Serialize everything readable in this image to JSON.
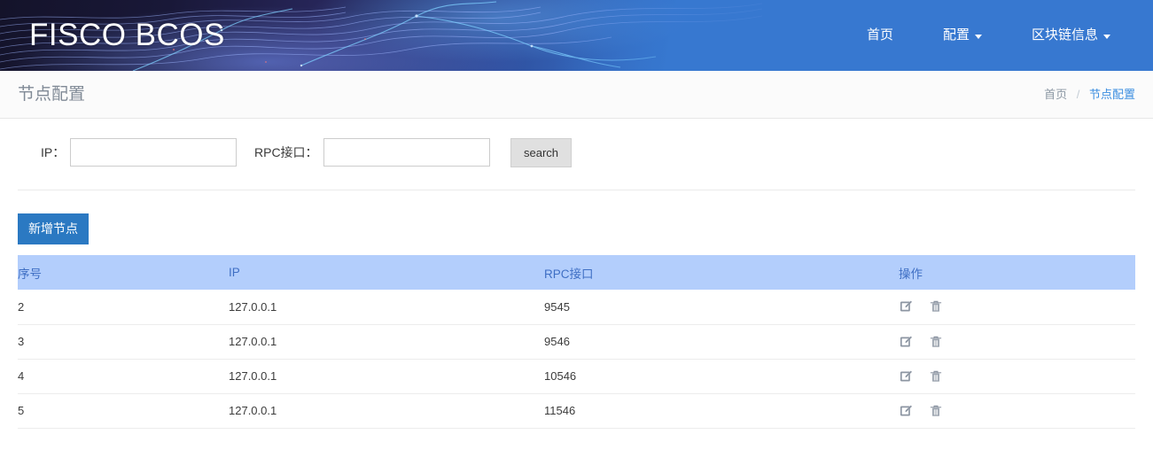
{
  "header": {
    "logo": "FISCO BCOS",
    "brand_color": "#3778d0",
    "nav": [
      {
        "label": "首页",
        "has_dropdown": false,
        "icon": ""
      },
      {
        "label": "配置",
        "has_dropdown": true,
        "icon": "chevron-down-icon"
      },
      {
        "label": "区块链信息",
        "has_dropdown": true,
        "icon": "chevron-down-icon"
      }
    ]
  },
  "subheader": {
    "page_title": "节点配置",
    "breadcrumb": {
      "home": "首页",
      "separator": "/",
      "current": "节点配置",
      "current_color": "#3b8ee0"
    }
  },
  "search": {
    "ip": {
      "label": "IP：",
      "value": "",
      "placeholder": ""
    },
    "rpc": {
      "label": "RPC接口：",
      "value": "",
      "placeholder": ""
    },
    "button": "search"
  },
  "actions": {
    "add_node": "新增节点",
    "add_node_color": "#2b79c2"
  },
  "table": {
    "header_bg": "#b3cefc",
    "header_fg": "#3f6fc4",
    "columns": [
      "序号",
      "IP",
      "RPC接口",
      "操作"
    ],
    "row_actions": [
      {
        "name": "edit-icon",
        "title": "编辑"
      },
      {
        "name": "delete-icon",
        "title": "删除"
      }
    ],
    "rows": [
      {
        "index": "2",
        "ip": "127.0.0.1",
        "rpc": "9545"
      },
      {
        "index": "3",
        "ip": "127.0.0.1",
        "rpc": "9546"
      },
      {
        "index": "4",
        "ip": "127.0.0.1",
        "rpc": "10546"
      },
      {
        "index": "5",
        "ip": "127.0.0.1",
        "rpc": "11546"
      }
    ]
  }
}
